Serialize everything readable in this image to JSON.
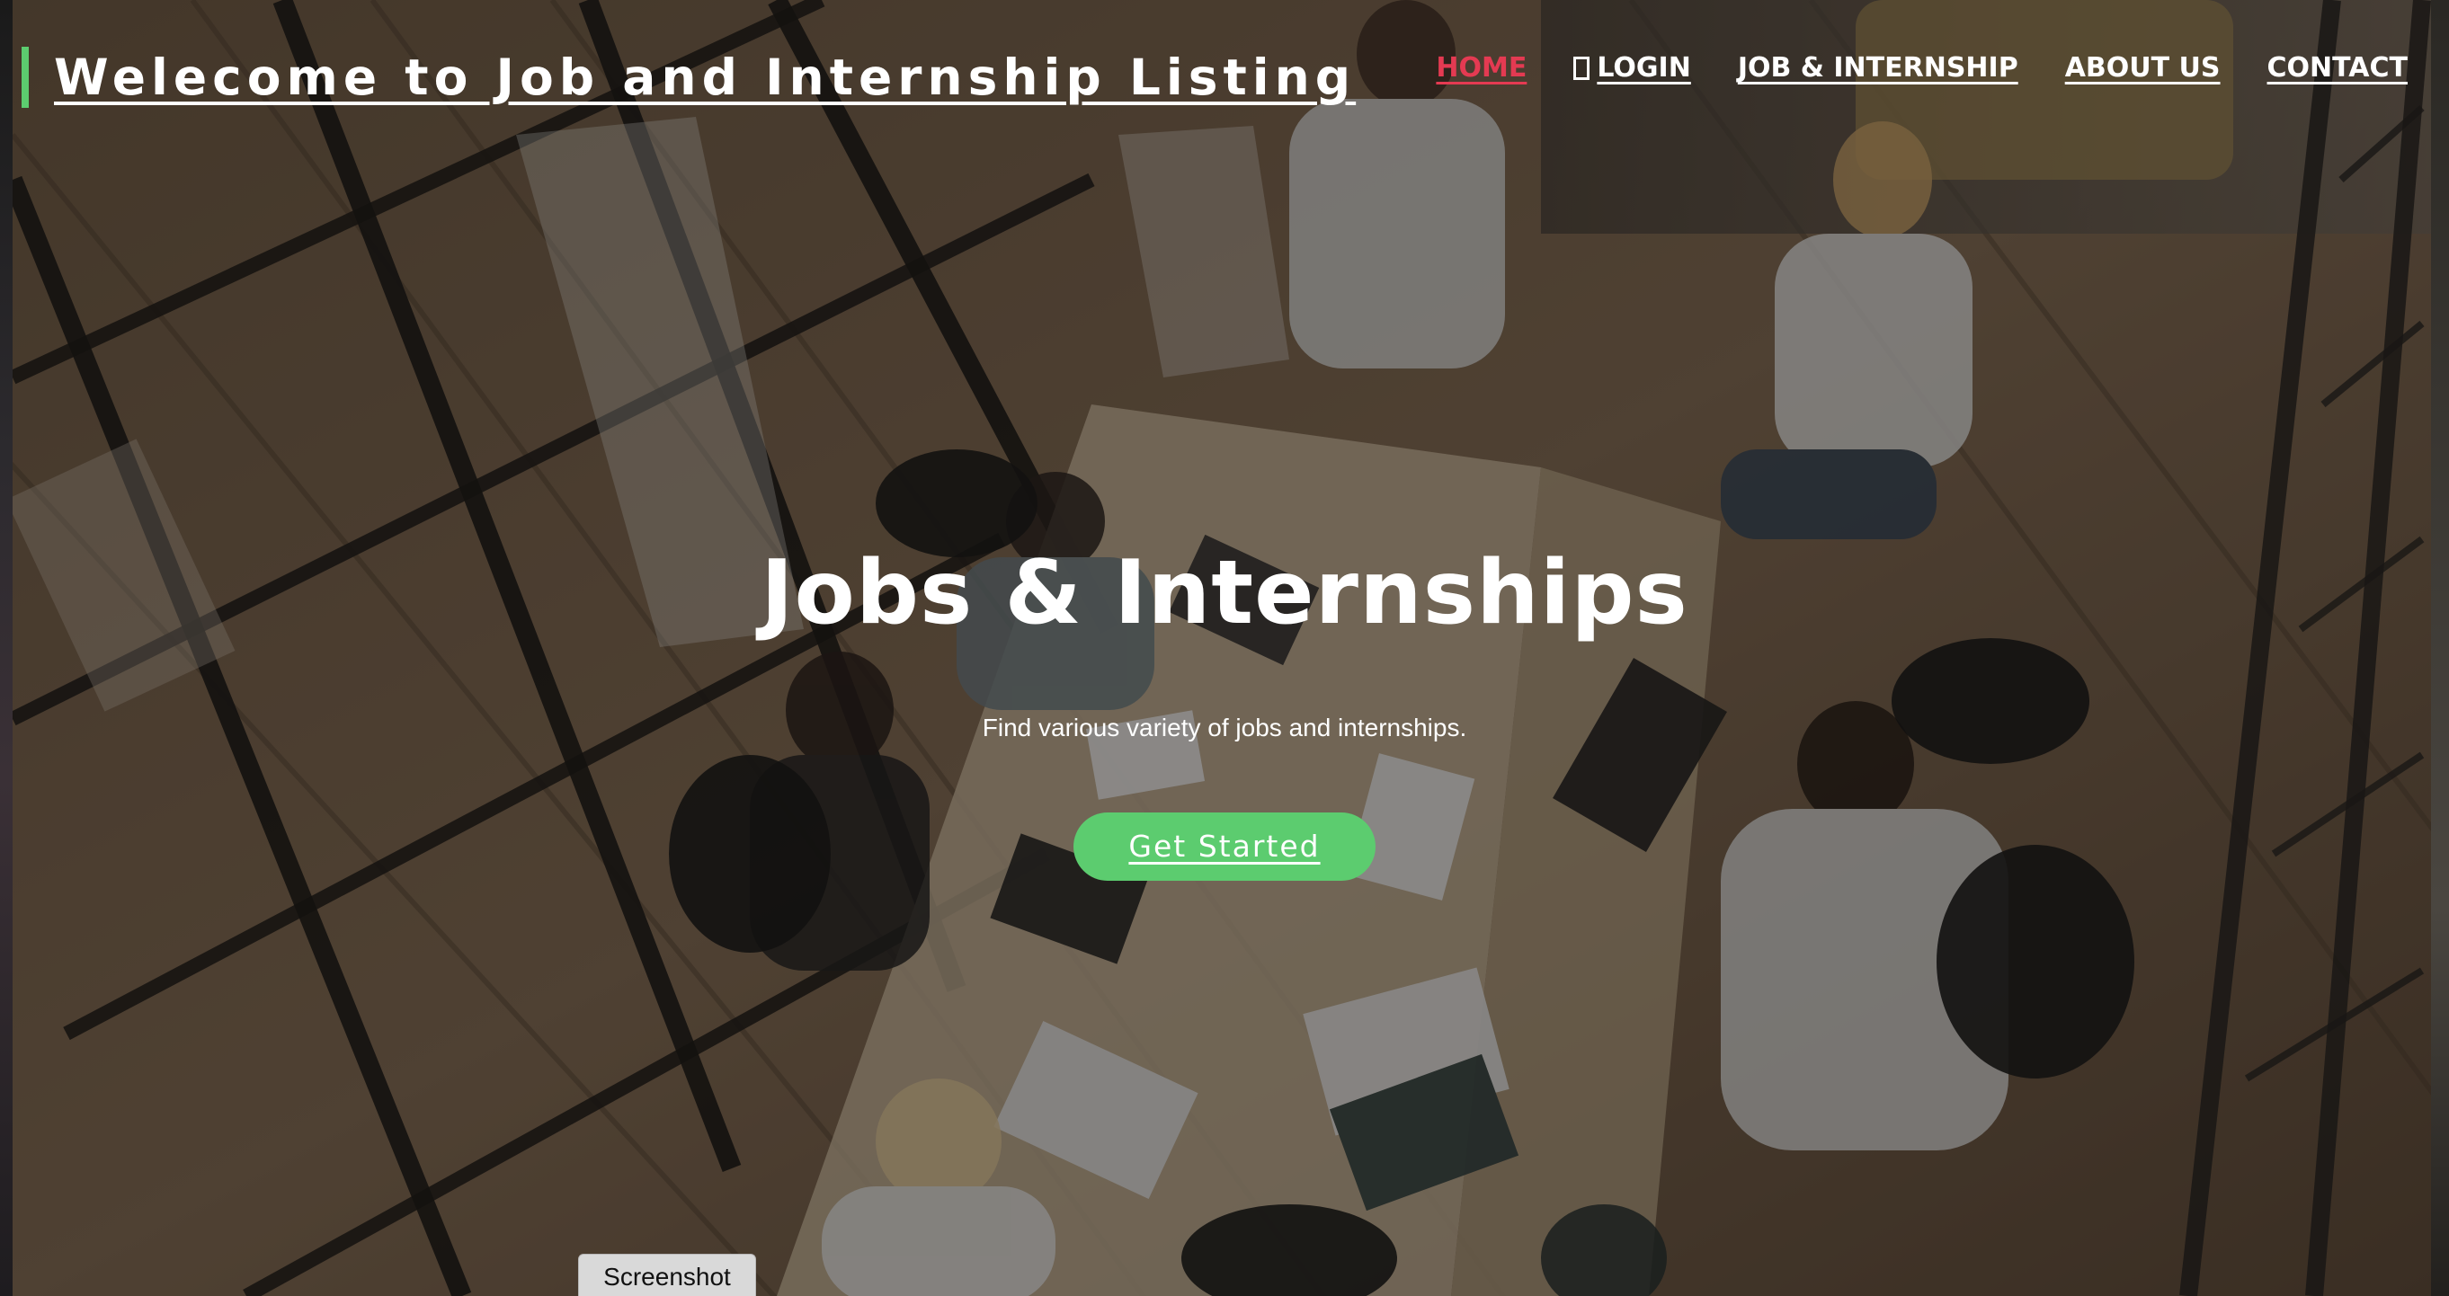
{
  "header": {
    "brand_title": "Welecome to Job and Internship Listing"
  },
  "nav": {
    "items": [
      {
        "label": "HOME",
        "active": true
      },
      {
        "label": "LOGIN",
        "icon": "login-icon"
      },
      {
        "label": "JOB & INTERNSHIP"
      },
      {
        "label": "ABOUT US"
      },
      {
        "label": "CONTACT"
      }
    ]
  },
  "hero": {
    "title": "Jobs & Internships",
    "subtitle": "Find various variety of jobs and internships.",
    "cta_label": "Get Started",
    "background": "office-meeting-photo"
  },
  "footer_tab": {
    "label": "Screenshot"
  },
  "colors": {
    "accent": "#5ccc6f",
    "active_nav": "#e43a52",
    "text": "#ffffff"
  }
}
